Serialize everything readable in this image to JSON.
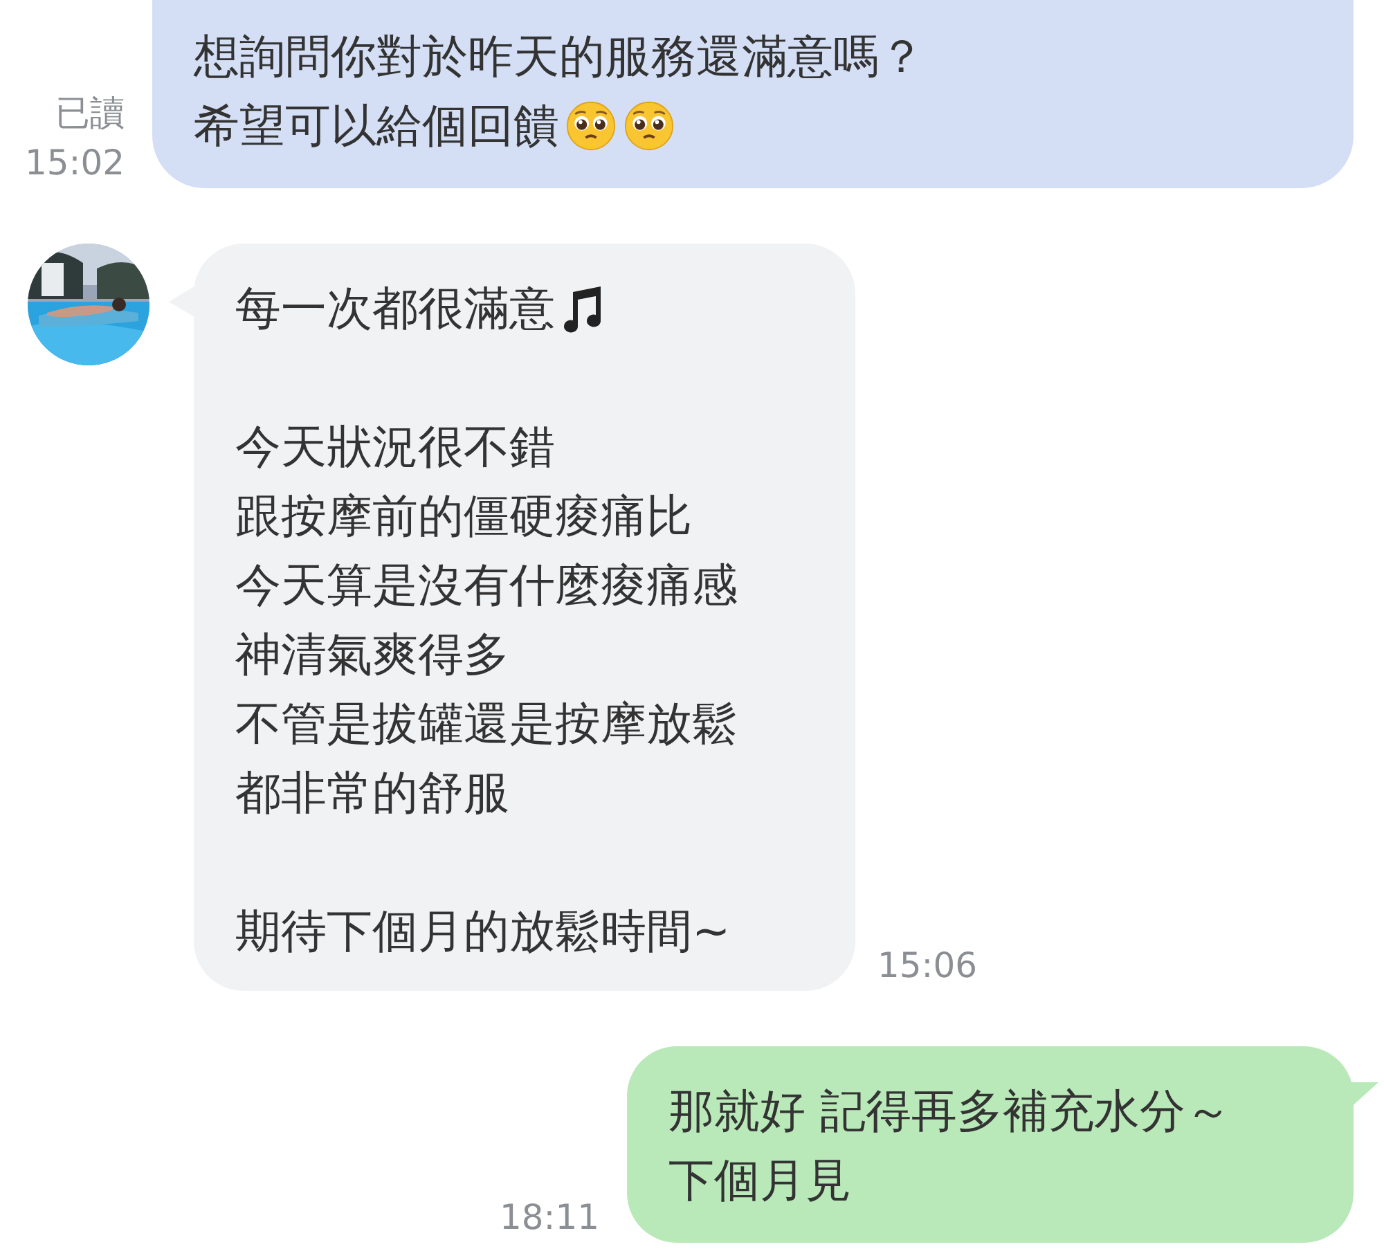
{
  "messages": [
    {
      "kind": "outgoing",
      "status": "已讀",
      "time": "15:02",
      "paragraphs": [
        [
          "想詢問你對於昨天的服務還滿意嗎？",
          "希望可以給個回饋"
        ]
      ]
    },
    {
      "kind": "incoming",
      "time": "15:06",
      "avatar": {
        "kind": "picture"
      },
      "paragraphs": [
        [
          "每一次都很滿意"
        ],
        [
          "今天狀況很不錯",
          "跟按摩前的僵硬痠痛比",
          "今天算是沒有什麼痠痛感",
          "神清氣爽得多",
          "不管是拔罐還是按摩放鬆",
          "都非常的舒服"
        ],
        [
          "期待下個月的放鬆時間~"
        ]
      ]
    },
    {
      "kind": "sent",
      "time": "18:11",
      "paragraphs": [
        [
          "那就好 記得再多補充水分～",
          "下個月見"
        ]
      ]
    }
  ]
}
